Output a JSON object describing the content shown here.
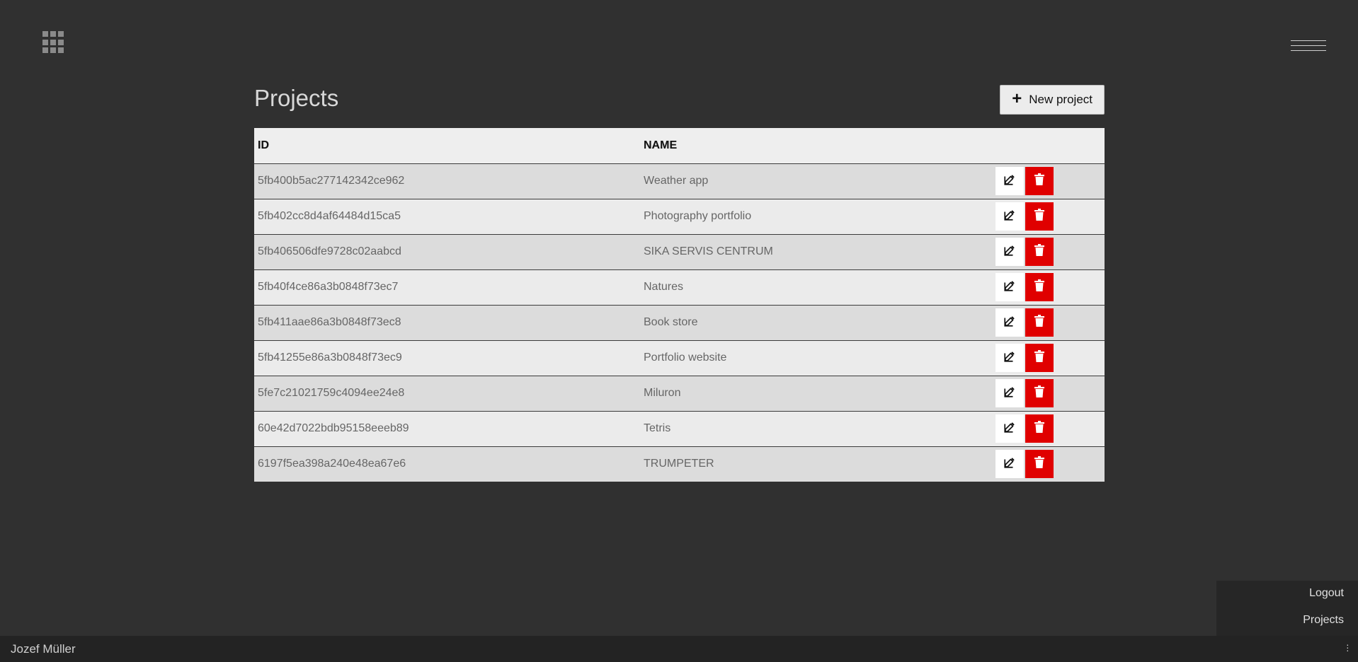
{
  "header": {
    "apps_icon": "grid-icon",
    "menu_icon": "hamburger-icon"
  },
  "page": {
    "title": "Projects",
    "new_button": "New project"
  },
  "table": {
    "columns": [
      "ID",
      "NAME"
    ],
    "rows": [
      {
        "id": "5fb400b5ac277142342ce962",
        "name": "Weather app"
      },
      {
        "id": "5fb402cc8d4af64484d15ca5",
        "name": "Photography portfolio"
      },
      {
        "id": "5fb406506dfe9728c02aabcd",
        "name": "SIKA SERVIS CENTRUM"
      },
      {
        "id": "5fb40f4ce86a3b0848f73ec7",
        "name": "Natures"
      },
      {
        "id": "5fb411aae86a3b0848f73ec8",
        "name": "Book store"
      },
      {
        "id": "5fb41255e86a3b0848f73ec9",
        "name": "Portfolio website"
      },
      {
        "id": "5fe7c21021759c4094ee24e8",
        "name": "Miluron"
      },
      {
        "id": "60e42d7022bdb95158eeeb89",
        "name": "Tetris"
      },
      {
        "id": "6197f5ea398a240e48ea67e6",
        "name": "TRUMPETER"
      }
    ]
  },
  "side_menu": {
    "logout": "Logout",
    "projects": "Projects"
  },
  "footer": {
    "user_name": "Jozef Müller"
  },
  "colors": {
    "background": "#303030",
    "delete": "#e00000",
    "row_odd": "#dcdcdc",
    "row_even": "#ebebeb"
  }
}
